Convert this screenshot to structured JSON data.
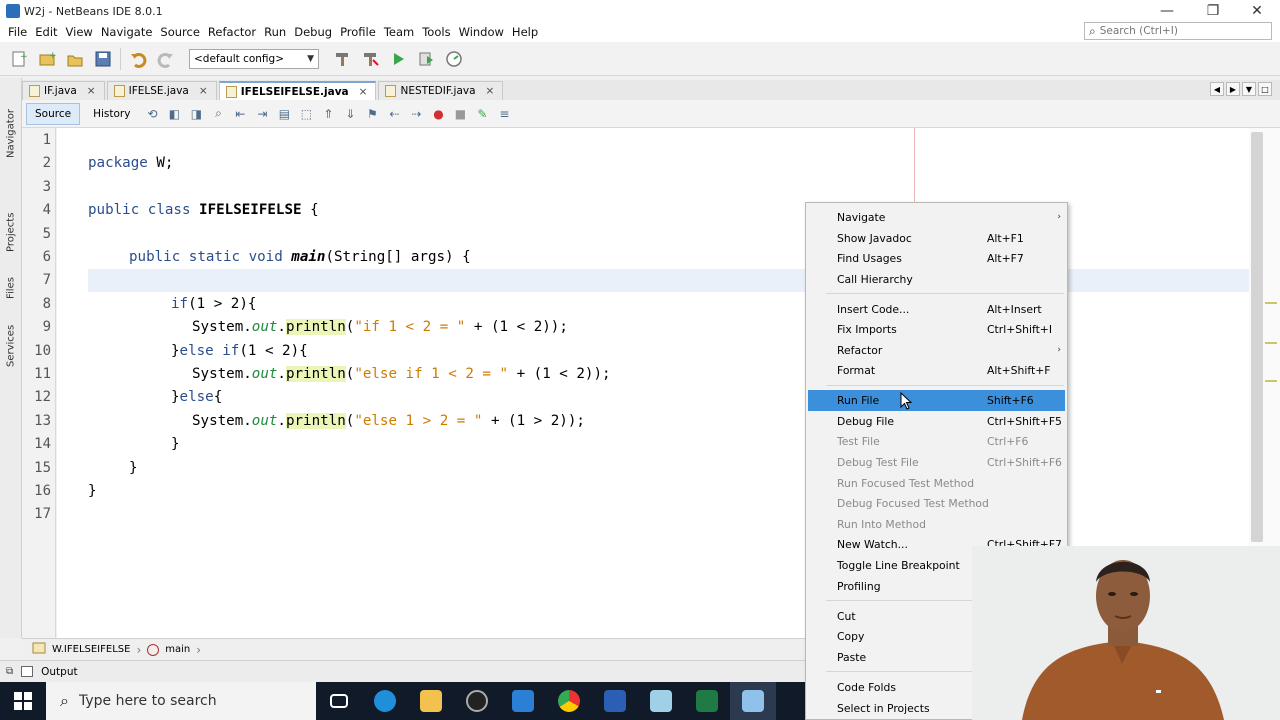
{
  "window": {
    "title": "W2j - NetBeans IDE 8.0.1",
    "controls": [
      "—",
      "❐",
      "✕"
    ]
  },
  "menubar": [
    "File",
    "Edit",
    "View",
    "Navigate",
    "Source",
    "Refactor",
    "Run",
    "Debug",
    "Profile",
    "Team",
    "Tools",
    "Window",
    "Help"
  ],
  "search": {
    "placeholder": "Search (Ctrl+I)"
  },
  "toolbar": {
    "config": "<default config>"
  },
  "sidebar": {
    "tabs": [
      "Navigator",
      "Projects",
      "Files",
      "Services"
    ]
  },
  "editor_tabs": [
    {
      "label": "IF.java",
      "active": false
    },
    {
      "label": "IFELSE.java",
      "active": false
    },
    {
      "label": "IFELSEIFELSE.java",
      "active": true
    },
    {
      "label": "NESTEDIF.java",
      "active": false
    }
  ],
  "subtoolbar": {
    "source": "Source",
    "history": "History"
  },
  "code": {
    "line_numbers": [
      "1",
      "2",
      "3",
      "4",
      "5",
      "6",
      "7",
      "8",
      "9",
      "10",
      "11",
      "12",
      "13",
      "14",
      "15",
      "16",
      "17"
    ],
    "current_line": 7
  },
  "breadcrumb": {
    "class": "W.IFELSEIFELSE",
    "method": "main"
  },
  "output": {
    "label": "Output"
  },
  "taskbar": {
    "search_placeholder": "Type here to search"
  },
  "context_menu": {
    "items": [
      {
        "label": "Navigate",
        "shortcut": "",
        "submenu": true,
        "enabled": true,
        "selected": false
      },
      {
        "label": "Show Javadoc",
        "shortcut": "Alt+F1",
        "enabled": true,
        "selected": false
      },
      {
        "label": "Find Usages",
        "shortcut": "Alt+F7",
        "enabled": true,
        "selected": false
      },
      {
        "label": "Call Hierarchy",
        "shortcut": "",
        "enabled": true,
        "selected": false
      },
      {
        "separator": true
      },
      {
        "label": "Insert Code...",
        "shortcut": "Alt+Insert",
        "enabled": true,
        "selected": false
      },
      {
        "label": "Fix Imports",
        "shortcut": "Ctrl+Shift+I",
        "enabled": true,
        "selected": false
      },
      {
        "label": "Refactor",
        "shortcut": "",
        "submenu": true,
        "enabled": true,
        "selected": false
      },
      {
        "label": "Format",
        "shortcut": "Alt+Shift+F",
        "enabled": true,
        "selected": false
      },
      {
        "separator": true
      },
      {
        "label": "Run File",
        "shortcut": "Shift+F6",
        "enabled": true,
        "selected": true
      },
      {
        "label": "Debug File",
        "shortcut": "Ctrl+Shift+F5",
        "enabled": true,
        "selected": false
      },
      {
        "label": "Test File",
        "shortcut": "Ctrl+F6",
        "enabled": false,
        "selected": false
      },
      {
        "label": "Debug Test File",
        "shortcut": "Ctrl+Shift+F6",
        "enabled": false,
        "selected": false
      },
      {
        "label": "Run Focused Test Method",
        "shortcut": "",
        "enabled": false,
        "selected": false
      },
      {
        "label": "Debug Focused Test Method",
        "shortcut": "",
        "enabled": false,
        "selected": false
      },
      {
        "label": "Run Into Method",
        "shortcut": "",
        "enabled": false,
        "selected": false
      },
      {
        "label": "New Watch...",
        "shortcut": "Ctrl+Shift+F7",
        "enabled": true,
        "selected": false
      },
      {
        "label": "Toggle Line Breakpoint",
        "shortcut": "",
        "enabled": true,
        "selected": false
      },
      {
        "label": "Profiling",
        "shortcut": "",
        "enabled": true,
        "selected": false
      },
      {
        "separator": true
      },
      {
        "label": "Cut",
        "shortcut": "",
        "enabled": true,
        "selected": false
      },
      {
        "label": "Copy",
        "shortcut": "",
        "enabled": true,
        "selected": false
      },
      {
        "label": "Paste",
        "shortcut": "",
        "enabled": true,
        "selected": false
      },
      {
        "separator": true
      },
      {
        "label": "Code Folds",
        "shortcut": "",
        "enabled": true,
        "selected": false
      },
      {
        "label": "Select in Projects",
        "shortcut": "",
        "enabled": true,
        "selected": false
      }
    ]
  },
  "colors": {
    "keyword": "#2b4e8c",
    "string": "#ce7b00",
    "field": "#1e8c3a",
    "selection": "#3c8fdb",
    "taskbar": "#101a28"
  }
}
